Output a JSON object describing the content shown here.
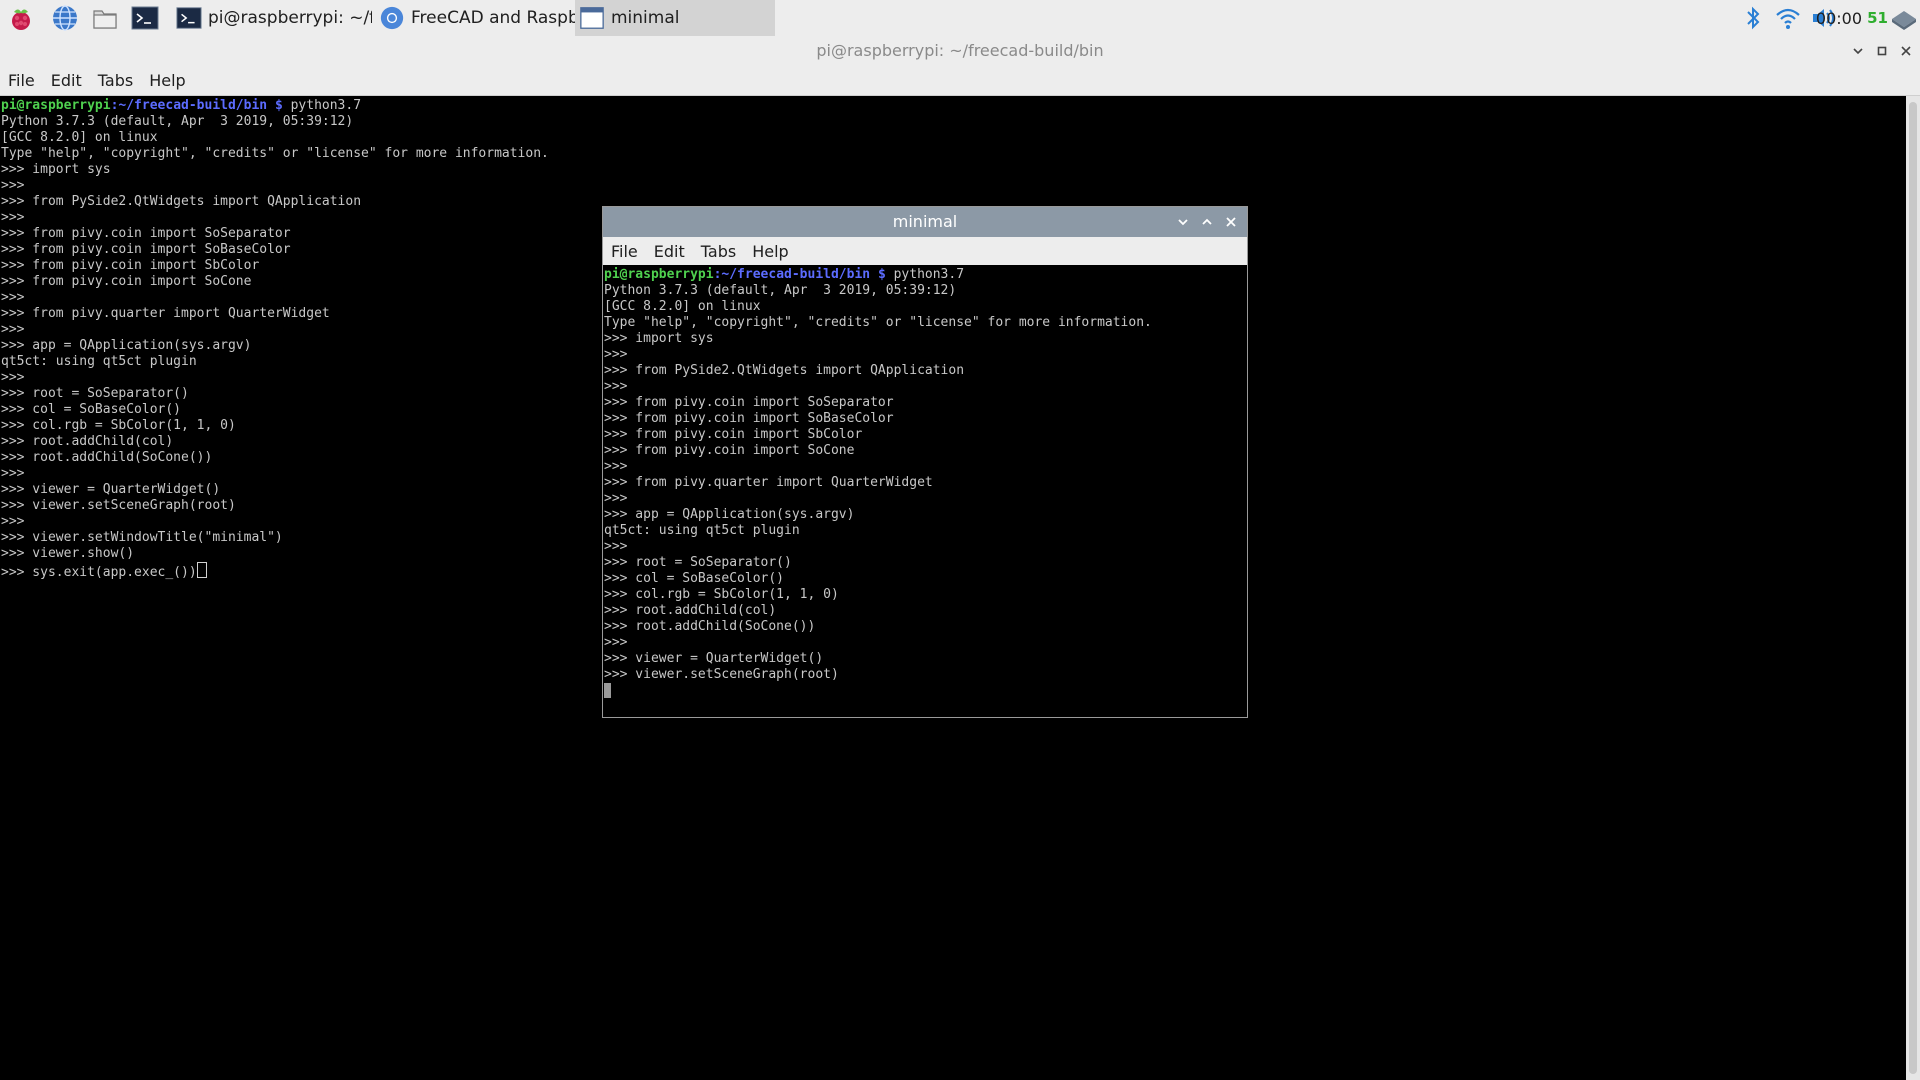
{
  "taskbar": {
    "tasks": [
      {
        "label": "pi@raspberrypi: ~/fre..."
      },
      {
        "label": "FreeCAD and Raspbe..."
      },
      {
        "label": "minimal"
      }
    ],
    "clock": "00:00",
    "cpu": "51"
  },
  "main_window": {
    "title": "pi@raspberrypi: ~/freecad-build/bin",
    "menu": [
      "File",
      "Edit",
      "Tabs",
      "Help"
    ],
    "prompt_user": "pi@raspberrypi",
    "prompt_path": ":~/freecad-build/bin $",
    "command": " python3.7",
    "lines": [
      "Python 3.7.3 (default, Apr  3 2019, 05:39:12)",
      "[GCC 8.2.0] on linux",
      "Type \"help\", \"copyright\", \"credits\" or \"license\" for more information.",
      ">>> import sys",
      ">>>",
      ">>> from PySide2.QtWidgets import QApplication",
      ">>>",
      ">>> from pivy.coin import SoSeparator",
      ">>> from pivy.coin import SoBaseColor",
      ">>> from pivy.coin import SbColor",
      ">>> from pivy.coin import SoCone",
      ">>>",
      ">>> from pivy.quarter import QuarterWidget",
      ">>>",
      ">>> app = QApplication(sys.argv)",
      "qt5ct: using qt5ct plugin",
      ">>>",
      ">>> root = SoSeparator()",
      ">>> col = SoBaseColor()",
      ">>> col.rgb = SbColor(1, 1, 0)",
      ">>> root.addChild(col)",
      ">>> root.addChild(SoCone())",
      ">>>",
      ">>> viewer = QuarterWidget()",
      ">>> viewer.setSceneGraph(root)",
      ">>>",
      ">>> viewer.setWindowTitle(\"minimal\")",
      ">>> viewer.show()"
    ],
    "last_line": ">>> sys.exit(app.exec_())"
  },
  "minimal_window": {
    "title": "minimal",
    "menu": [
      "File",
      "Edit",
      "Tabs",
      "Help"
    ],
    "prompt_user": "pi@raspberrypi",
    "prompt_path": ":~/freecad-build/bin $",
    "command": " python3.7",
    "lines": [
      "Python 3.7.3 (default, Apr  3 2019, 05:39:12)",
      "[GCC 8.2.0] on linux",
      "Type \"help\", \"copyright\", \"credits\" or \"license\" for more information.",
      ">>> import sys",
      ">>>",
      ">>> from PySide2.QtWidgets import QApplication",
      ">>>",
      ">>> from pivy.coin import SoSeparator",
      ">>> from pivy.coin import SoBaseColor",
      ">>> from pivy.coin import SbColor",
      ">>> from pivy.coin import SoCone",
      ">>>",
      ">>> from pivy.quarter import QuarterWidget",
      ">>>",
      ">>> app = QApplication(sys.argv)",
      "qt5ct: using qt5ct plugin",
      ">>>",
      ">>> root = SoSeparator()",
      ">>> col = SoBaseColor()",
      ">>> col.rgb = SbColor(1, 1, 0)",
      ">>> root.addChild(col)",
      ">>> root.addChild(SoCone())",
      ">>>",
      ">>> viewer = QuarterWidget()",
      ">>> viewer.setSceneGraph(root)"
    ]
  },
  "colors": {
    "prompt_user": "#4fd14f",
    "prompt_path": "#5c6cff",
    "terminal_text": "#c8c8c8",
    "minimal_titlebar": "#8c99a6",
    "tray_icon": "#2a7fd4"
  }
}
